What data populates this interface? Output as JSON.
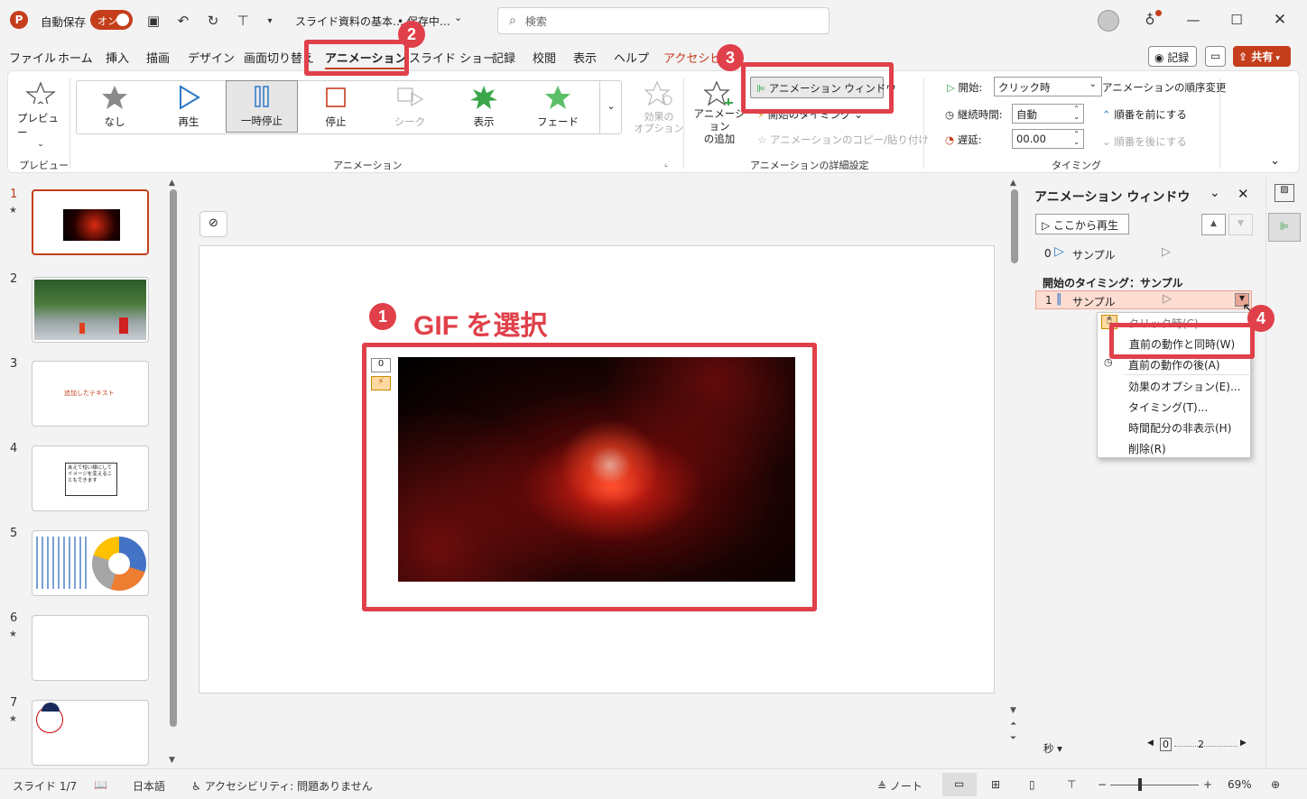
{
  "titlebar": {
    "autosave_label": "自動保存",
    "autosave_toggle": "オン",
    "doc_title": "スライド資料の基本…",
    "save_status": "• 保存中…",
    "search_placeholder": "検索"
  },
  "menu": {
    "items": [
      "ファイル",
      "ホーム",
      "挿入",
      "描画",
      "デザイン",
      "画面切り替え",
      "アニメーション",
      "スライド ショー",
      "記録",
      "校閲",
      "表示",
      "ヘルプ",
      "アクセシビリティ"
    ],
    "record_button": "記録",
    "share_button": "共有"
  },
  "ribbon": {
    "preview_button": "プレビュー",
    "preview_group": "プレビュー",
    "animations": [
      "なし",
      "再生",
      "一時停止",
      "停止",
      "シーク",
      "表示",
      "フェード"
    ],
    "effect_options": "効果の\nオプション",
    "animation_group": "アニメーション",
    "add_animation": "アニメーション\nの追加",
    "animation_pane_button": "アニメーション ウィンドウ",
    "trigger": "開始のタイミング",
    "anim_painter": "アニメーションのコピー/貼り付け",
    "advanced_group": "アニメーションの詳細設定",
    "start_label": "開始:",
    "start_value": "クリック時",
    "duration_label": "継続時間:",
    "duration_value": "自動",
    "delay_label": "遅延:",
    "delay_value": "00.00",
    "reorder_title": "アニメーションの順序変更",
    "move_earlier": "順番を前にする",
    "move_later": "順番を後にする",
    "timing_group": "タイミング"
  },
  "slides": {
    "numbers": [
      "1",
      "2",
      "3",
      "4",
      "5",
      "6",
      "7"
    ],
    "slide3_text": "追加したテキスト",
    "slide4_text": "あえて短い線にしてイメージを変えることもできます"
  },
  "canvas": {
    "annotation": "GIF を選択",
    "anim_index": "0"
  },
  "badges": [
    "1",
    "2",
    "3",
    "4"
  ],
  "pane": {
    "title": "アニメーション ウィンドウ",
    "play_from": "ここから再生",
    "item0_index": "0",
    "item0_name": "サンプル",
    "trigger_header": "開始のタイミング：サンプル",
    "item1_index": "1",
    "item1_name": "サンプル",
    "context_items": [
      "クリック時(C)",
      "直前の動作と同時(W)",
      "直前の動作の後(A)",
      "効果のオプション(E)...",
      "タイミング(T)...",
      "時間配分の非表示(H)",
      "削除(R)"
    ],
    "seconds_label": "秒",
    "timeline_start": "0",
    "timeline_mark": "2"
  },
  "status": {
    "slide_count": "スライド 1/7",
    "language": "日本語",
    "accessibility": "アクセシビリティ: 問題ありません",
    "notes": "ノート",
    "zoom": "69%"
  }
}
